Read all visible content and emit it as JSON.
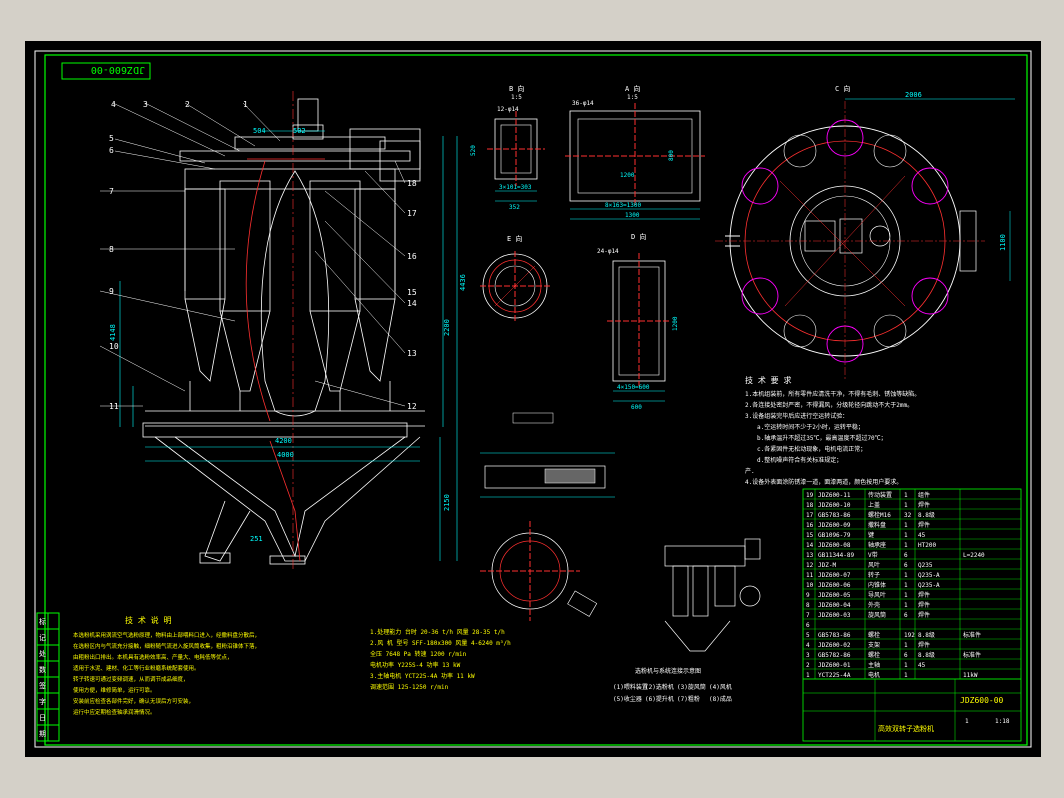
{
  "drawing_number_top": "JDZ600-00",
  "part_callouts": [
    "1",
    "2",
    "3",
    "4",
    "5",
    "6",
    "7",
    "8",
    "9",
    "10",
    "11",
    "12",
    "13",
    "14",
    "15",
    "16",
    "17",
    "18"
  ],
  "views": {
    "a_label": "A 向",
    "b_label": "B 向",
    "c_label": "C 向",
    "d_label": "D 向",
    "e_label": "E 向",
    "scale_label": "1:1",
    "scale_label_2": "1:5"
  },
  "dimensions": {
    "overall_height": "4436",
    "upper_height": "2200",
    "lower_height": "2150",
    "base_width": "4000",
    "base_inner": "4200",
    "main_diameter": "2006",
    "right_side": "1100",
    "a_view_width": "1300",
    "a_view_bolts": "8×163=1300",
    "a_view_inner": "1200",
    "b_view_width": "352",
    "b_view_bolts": "3×101=303",
    "b_view_holes": "12-φ14",
    "a_view_holes": "36-φ14",
    "d_view_width": "600",
    "d_view_bolts": "4×150=600",
    "d_view_holes": "24-φ14",
    "dim_504": "504",
    "dim_502": "502",
    "dim_4148": "4148",
    "dim_1001": "1001",
    "dim_520": "520",
    "dim_800": "800",
    "dim_1200b": "1200",
    "dim_251": "251"
  },
  "tech_requirements": {
    "title": "技 术 要 求",
    "lines": [
      "1.本机组装前，所有零件应清洗干净，不得有毛刺、锈蚀等缺陷。",
      "2.各连接处密封严密，不得漏风，分级轮径向跳动不大于2mm。",
      "3.设备组装完毕后应进行空运转试验：",
      "a.空运转时间不少于2小时，运转平稳；",
      "b.轴承温升不超过35℃，最高温度不超过70℃；",
      "c.各紧固件无松动现象，电机电流正常；",
      "d.整机噪声符合有关标准规定；",
      "产.",
      "4.设备外表面涂防锈漆一道，面漆两道，颜色按用户要求。"
    ]
  },
  "tech_specs": {
    "lines": [
      "1.处理能力  台时 20-36 t/h   风量 28-35 t/h",
      "2.风  机  型号 SFF-180x300  风量 4-6240 m³/h",
      "        全压 7648 Pa    转速 1200 r/min",
      "  电机功率 Y225S-4   功率 13 kW",
      "3.主轴电机 YCT225-4A  功率 11 kW",
      "  调速范围 125-1250 r/min"
    ]
  },
  "notes": {
    "title": "技 术 说 明",
    "lines": [
      "本选粉机采用涡流空气选粉原理，物料由上部喂料口进入，经撒料盘分散后，",
      "在选粉区内与气流充分接触，细粉随气流进入旋风筒收集，粗粉沿锥体下落，",
      "由粗粉出口排出。本机具有选粉效率高、产量大、电耗低等优点，",
      "适用于水泥、建材、化工等行业粉磨系统配套使用。",
      "转子转速可通过变频调速，从而调节成品细度，",
      "使用方便，维修简单，运行可靠。",
      "安装前应检查各部件完好，确认无误后方可安装，",
      "运行中应定期检查轴承润滑情况。"
    ]
  },
  "install_legend": {
    "title": "选粉机与系统连接示意图",
    "items": [
      "(1)喂料装置",
      "(2)选粉机",
      "(3)旋风筒",
      "(4)风机",
      "(5)收尘器",
      "(6)提升机",
      "(7)粗粉",
      "(8)成品"
    ]
  },
  "bom": {
    "rows": [
      {
        "no": "19",
        "code": "JDZ600-11",
        "name": "传动装置",
        "qty": "1",
        "mat": "组件"
      },
      {
        "no": "18",
        "code": "JDZ600-10",
        "name": "上盖",
        "qty": "1",
        "mat": "焊件"
      },
      {
        "no": "17",
        "code": "GB5783-86",
        "name": "螺栓M16",
        "qty": "32",
        "mat": "8.8级"
      },
      {
        "no": "16",
        "code": "JDZ600-09",
        "name": "撒料盘",
        "qty": "1",
        "mat": "焊件"
      },
      {
        "no": "15",
        "code": "GB1096-79",
        "name": "键",
        "qty": "1",
        "mat": "45"
      },
      {
        "no": "14",
        "code": "JDZ600-08",
        "name": "轴承座",
        "qty": "1",
        "mat": "HT200"
      },
      {
        "no": "13",
        "code": "GB11344-89",
        "name": "V带",
        "qty": "6",
        "mat": "",
        "note": "L=2240"
      },
      {
        "no": "12",
        "code": "JDZ-M",
        "name": "风叶",
        "qty": "6",
        "mat": "Q235"
      },
      {
        "no": "11",
        "code": "JDZ600-07",
        "name": "转子",
        "qty": "1",
        "mat": "Q235-A"
      },
      {
        "no": "10",
        "code": "JDZ600-06",
        "name": "内锥体",
        "qty": "1",
        "mat": "Q235-A"
      },
      {
        "no": "9",
        "code": "JDZ600-05",
        "name": "导风叶",
        "qty": "1",
        "mat": "焊件"
      },
      {
        "no": "8",
        "code": "JDZ600-04",
        "name": "外壳",
        "qty": "1",
        "mat": "焊件"
      },
      {
        "no": "7",
        "code": "JDZ600-03",
        "name": "旋风筒",
        "qty": "6",
        "mat": "焊件"
      },
      {
        "no": "6",
        "code": "",
        "name": "",
        "qty": "",
        "mat": ""
      },
      {
        "no": "5",
        "code": "GB5783-86",
        "name": "螺栓",
        "qty": "192",
        "mat": "8.8级",
        "note": "标准件"
      },
      {
        "no": "4",
        "code": "JDZ600-02",
        "name": "支架",
        "qty": "1",
        "mat": "焊件"
      },
      {
        "no": "3",
        "code": "GB5782-86",
        "name": "螺栓",
        "qty": "6",
        "mat": "8.8级",
        "note": "标准件"
      },
      {
        "no": "2",
        "code": "JDZ600-01",
        "name": "主轴",
        "qty": "1",
        "mat": "45"
      },
      {
        "no": "1",
        "code": "YCT225-4A",
        "name": "电机",
        "qty": "1",
        "mat": "",
        "note": "11kW"
      }
    ],
    "title_drawing_no": "JDZ600-00",
    "title_name": "高效双转子选粉机",
    "title_scale": "1:18",
    "title_sheet": "1"
  },
  "revision_strip": [
    "标",
    "记",
    "处",
    "数",
    "签",
    "字",
    "日",
    "期"
  ]
}
